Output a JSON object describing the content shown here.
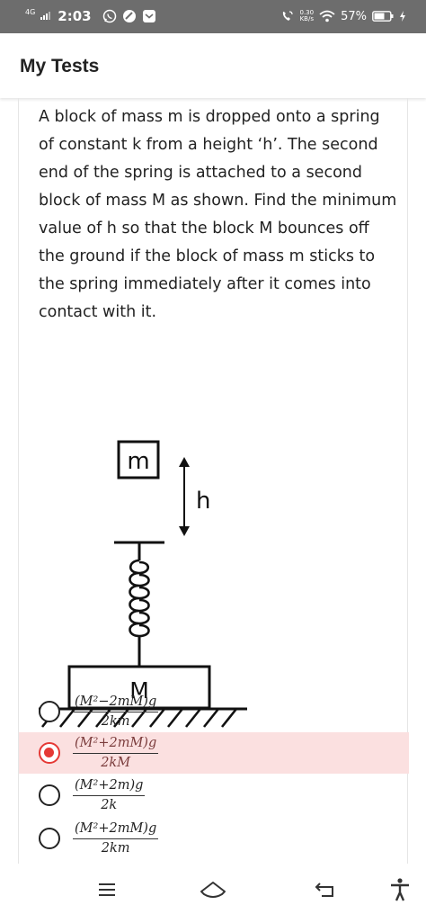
{
  "status_bar": {
    "network": "4G",
    "time": "2:03",
    "speed_value": "0.30",
    "speed_unit": "KB/s",
    "battery": "57%"
  },
  "app_bar": {
    "title": "My Tests"
  },
  "question": {
    "text": "A block of mass m is dropped onto a spring of constant k from a height ‘h’.  The second end of the spring is attached to a second block of mass M as shown.  Find the minimum value of h so that the block M bounces off the ground if the block of mass m sticks to the spring immediately after it comes into contact with it."
  },
  "figure": {
    "small_block_label": "m",
    "height_label": "h",
    "big_block_label": "M"
  },
  "options": [
    {
      "numerator": "(M²−2mM)g",
      "denominator": "2km",
      "selected": false
    },
    {
      "numerator": "(M²+2mM)g",
      "denominator": "2kM",
      "selected": true
    },
    {
      "numerator": "(M²+2m)g",
      "denominator": "2k",
      "selected": false
    },
    {
      "numerator": "(M²+2mM)g",
      "denominator": "2km",
      "selected": false
    }
  ],
  "icons": {
    "nav_recents": "recents-icon",
    "nav_home": "home-icon",
    "nav_back": "back-icon",
    "nav_accessibility": "accessibility-icon"
  },
  "colors": {
    "accent": "#e53935",
    "selected_bg": "#fbe0e0",
    "status_bar": "#6d6d6d"
  }
}
